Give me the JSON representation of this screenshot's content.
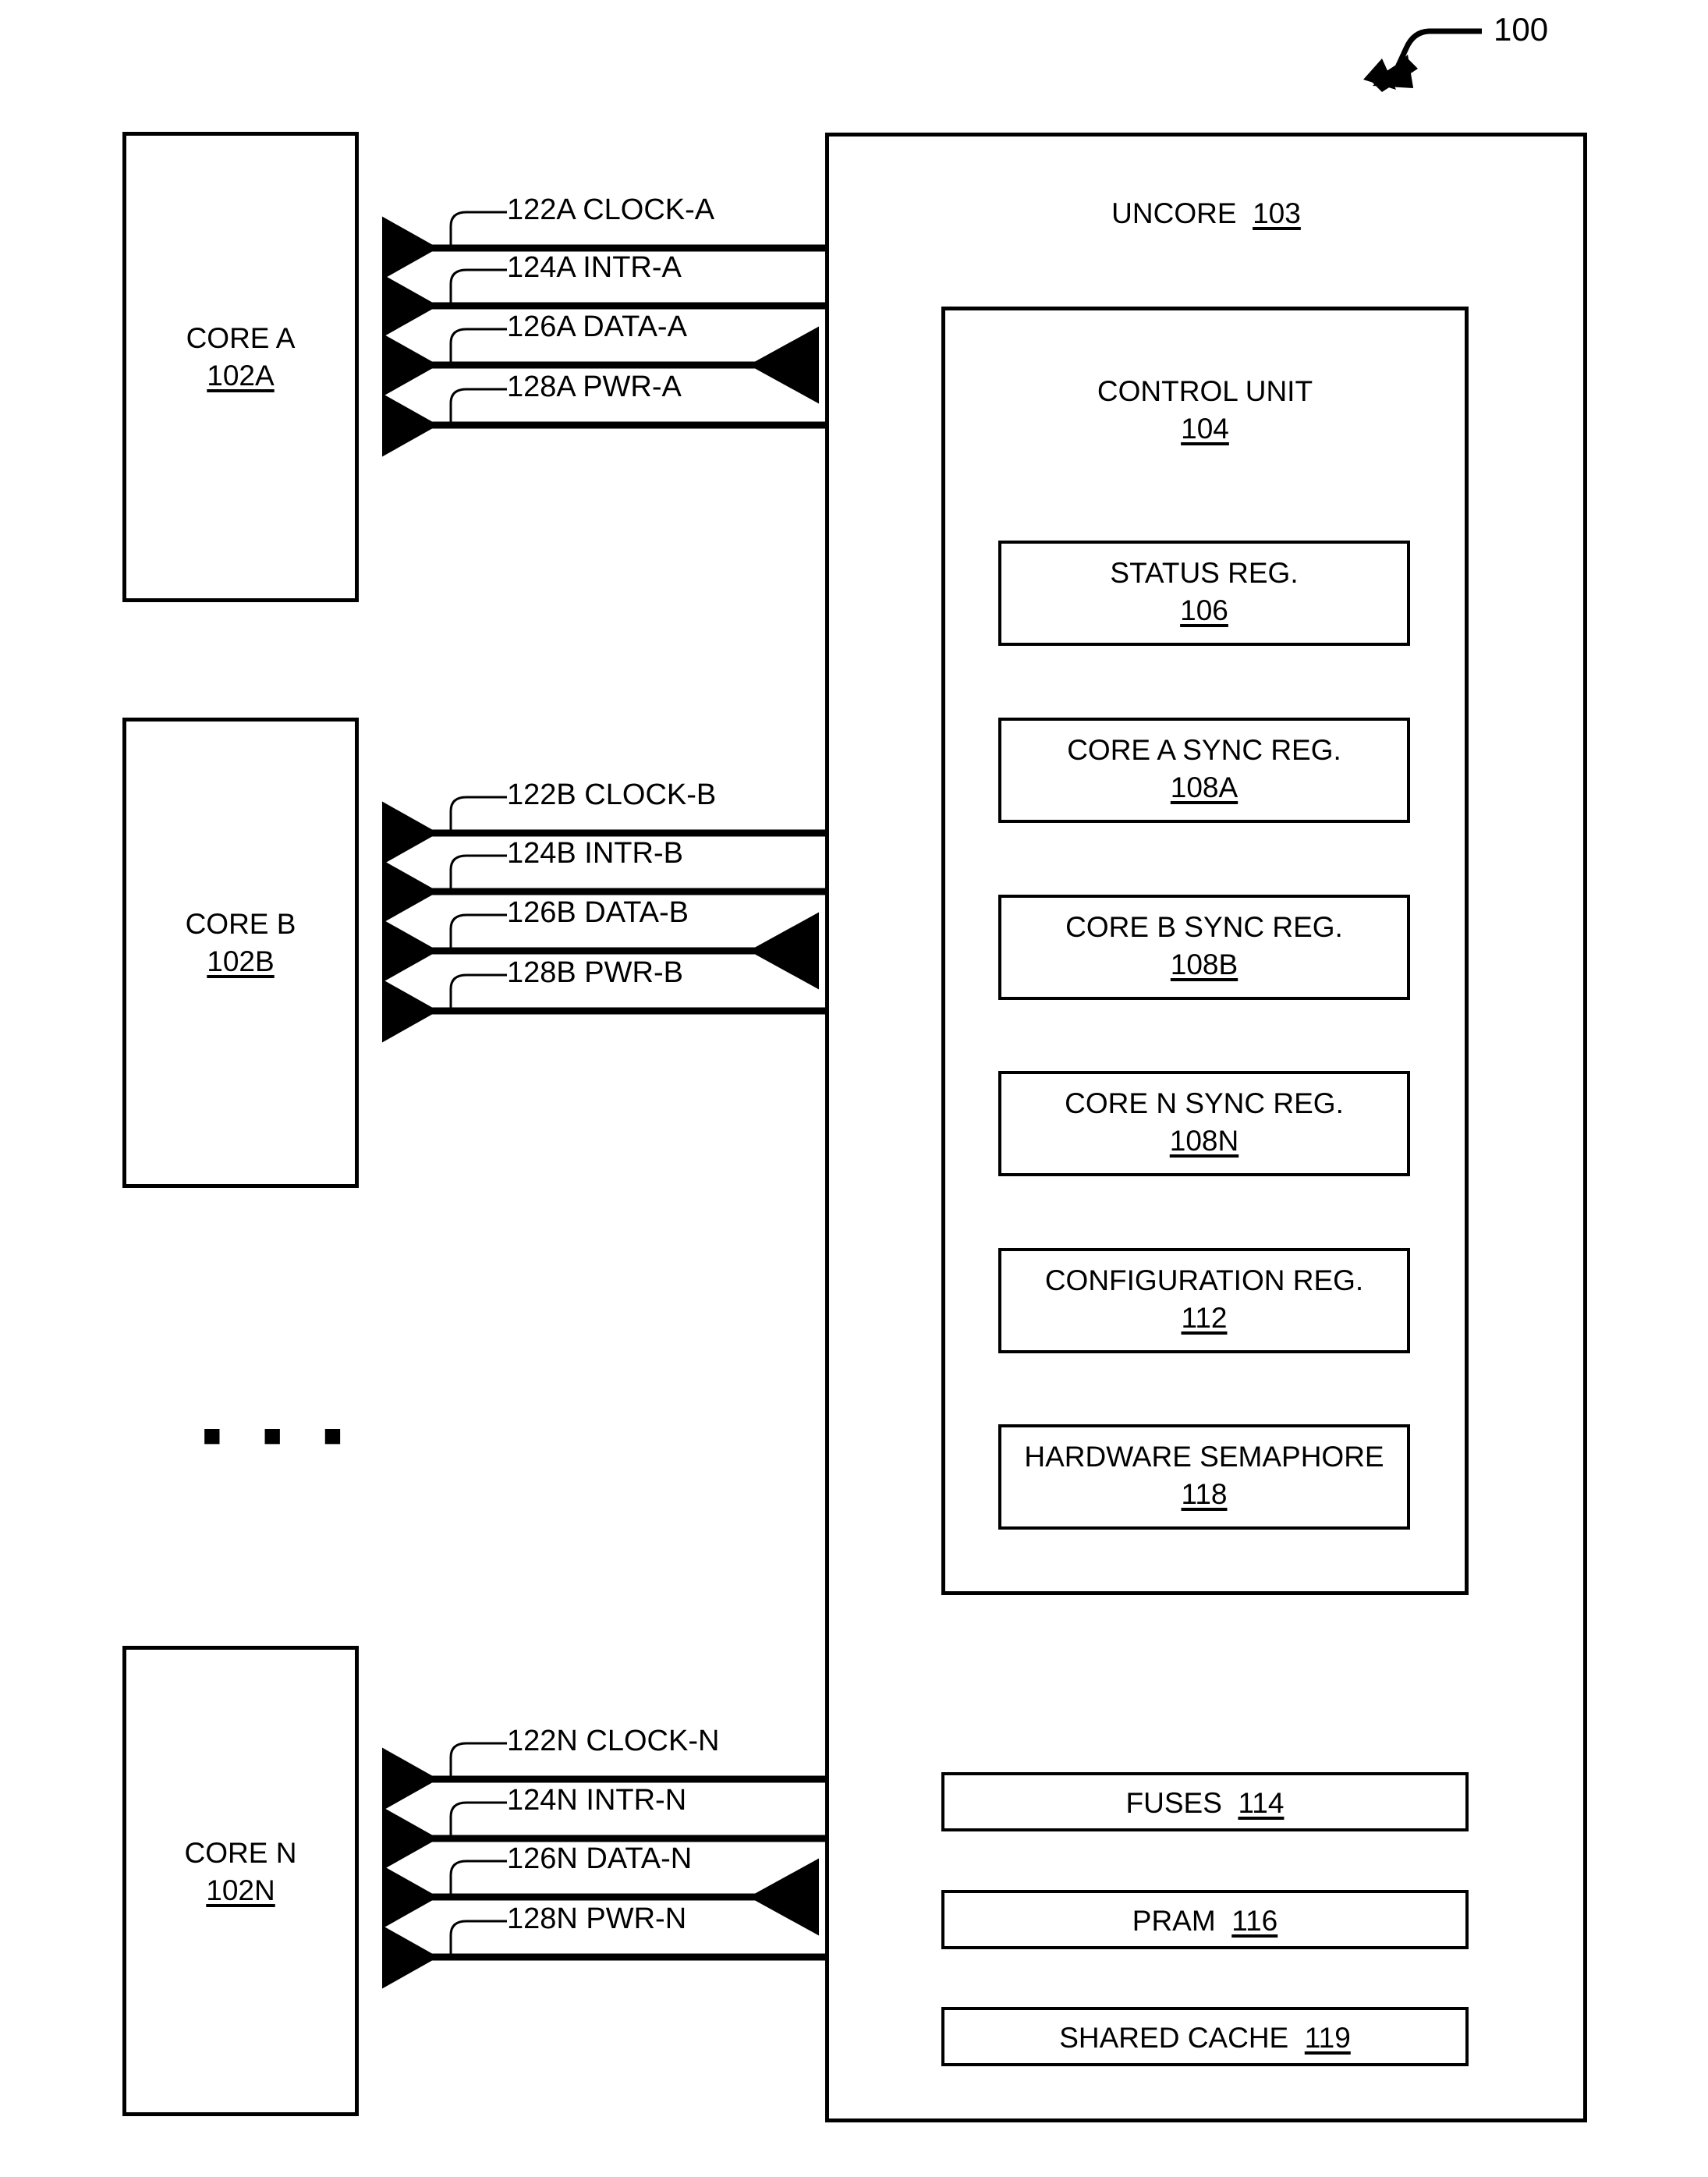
{
  "figure": {
    "reference_numeral": "100"
  },
  "cores": [
    {
      "name": "CORE A",
      "ref": "102A",
      "signals": [
        {
          "label": "122A CLOCK-A",
          "direction": "to-core"
        },
        {
          "label": "124A INTR-A",
          "direction": "to-core"
        },
        {
          "label": "126A DATA-A",
          "direction": "bidirectional"
        },
        {
          "label": "128A PWR-A",
          "direction": "to-core"
        }
      ]
    },
    {
      "name": "CORE B",
      "ref": "102B",
      "signals": [
        {
          "label": "122B CLOCK-B",
          "direction": "to-core"
        },
        {
          "label": "124B INTR-B",
          "direction": "to-core"
        },
        {
          "label": "126B DATA-B",
          "direction": "bidirectional"
        },
        {
          "label": "128B PWR-B",
          "direction": "to-core"
        }
      ]
    },
    {
      "name": "CORE N",
      "ref": "102N",
      "signals": [
        {
          "label": "122N CLOCK-N",
          "direction": "to-core"
        },
        {
          "label": "124N INTR-N",
          "direction": "to-core"
        },
        {
          "label": "126N DATA-N",
          "direction": "bidirectional"
        },
        {
          "label": "128N PWR-N",
          "direction": "to-core"
        }
      ]
    }
  ],
  "ellipsis": "▪ ▪ ▪",
  "uncore": {
    "title": "UNCORE",
    "ref": "103",
    "control_unit": {
      "title": "CONTROL UNIT",
      "ref": "104",
      "registers": [
        {
          "title": "STATUS REG.",
          "ref": "106"
        },
        {
          "title": "CORE A SYNC REG.",
          "ref": "108A"
        },
        {
          "title": "CORE B SYNC REG.",
          "ref": "108B"
        },
        {
          "title": "CORE N SYNC REG.",
          "ref": "108N"
        },
        {
          "title": "CONFIGURATION REG.",
          "ref": "112"
        },
        {
          "title": "HARDWARE SEMAPHORE",
          "ref": "118"
        }
      ]
    },
    "blocks": [
      {
        "title": "FUSES",
        "ref": "114"
      },
      {
        "title": "PRAM",
        "ref": "116"
      },
      {
        "title": "SHARED CACHE",
        "ref": "119"
      }
    ]
  },
  "colors": {
    "ink": "#000000",
    "paper": "#ffffff"
  }
}
